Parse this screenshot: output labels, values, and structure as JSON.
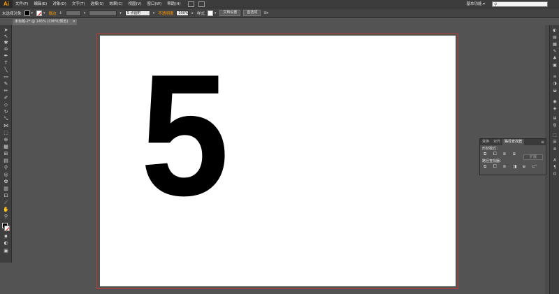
{
  "app": {
    "logo": "Ai"
  },
  "menu": {
    "items": [
      "文件(F)",
      "编辑(E)",
      "对象(O)",
      "文字(T)",
      "选择(S)",
      "效果(C)",
      "视图(V)",
      "窗口(W)",
      "帮助(H)"
    ],
    "workspace": "基本功能 ▾",
    "search_placeholder": ""
  },
  "controlbar": {
    "selection": "未选择对象",
    "stroke_label": "描边",
    "point": "5 点圆形",
    "opacity_label": "不透明度",
    "opacity_value": "100%",
    "style_label": "样式",
    "doc_setup": "文档设置",
    "prefs": "首选项"
  },
  "document": {
    "tab_title": "未标题-2* @ 145% (CMYK/预览)",
    "content": "5"
  },
  "panel": {
    "tabs": [
      "变换",
      "对齐",
      "路径查找器"
    ],
    "section1": "形状模式：",
    "section2": "路径查找器：",
    "expand": "扩展"
  },
  "colors": {
    "accent": "#ff9a00",
    "artboard_border": "#c03a3a",
    "background": "#535353"
  }
}
